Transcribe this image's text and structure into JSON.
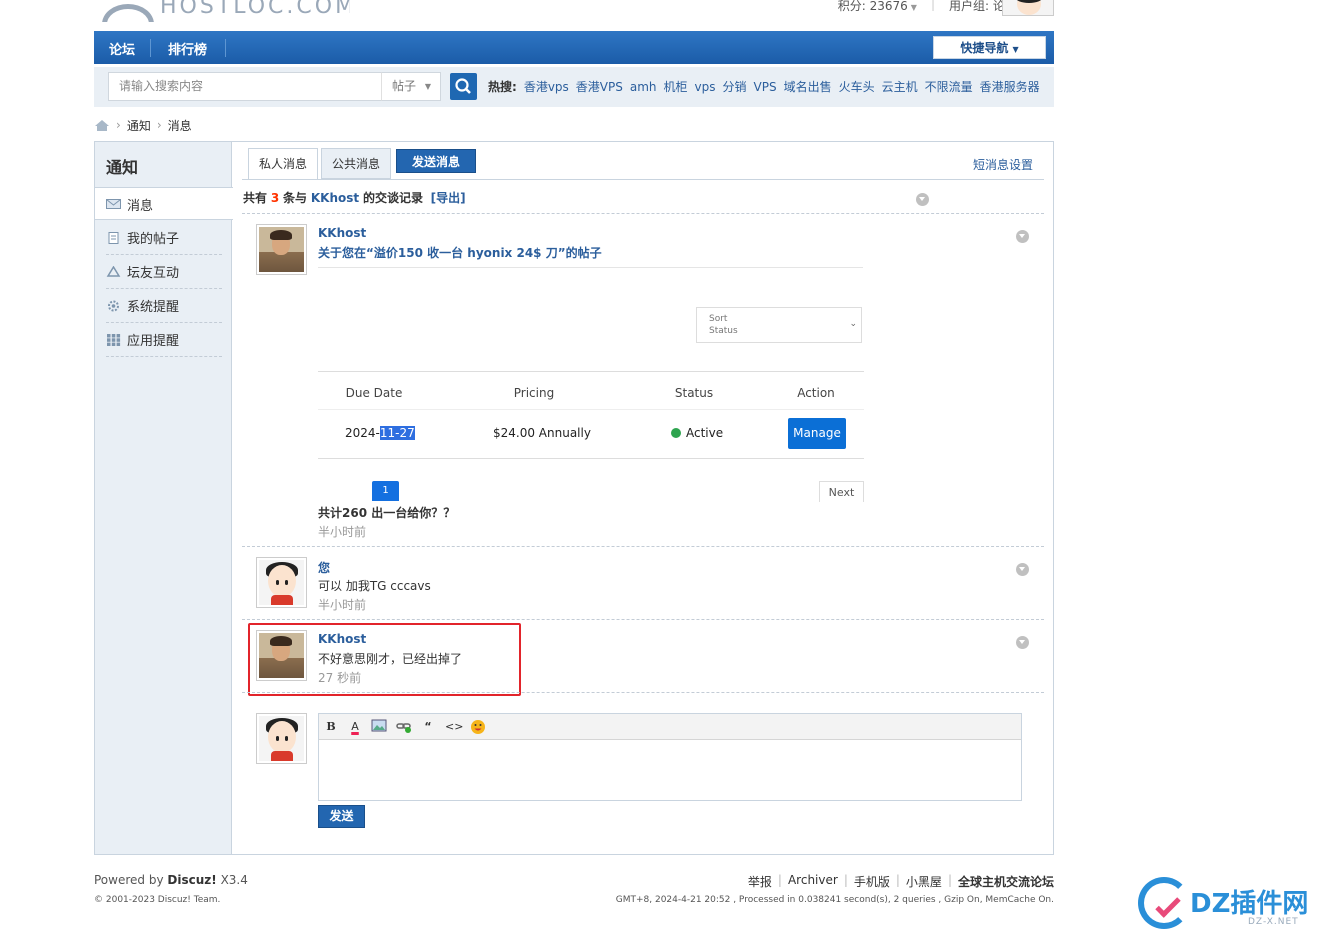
{
  "header": {
    "logo_text": "HOSTLOC.COM",
    "points": "积分: 23676",
    "usergroup": "用户组: 论坛神仙"
  },
  "nav": {
    "items": [
      "论坛",
      "排行榜"
    ],
    "quick_nav": "快捷导航"
  },
  "search": {
    "placeholder": "请输入搜索内容",
    "type": "帖子",
    "hot_label": "热搜:",
    "hot_keywords": [
      "香港vps",
      "香港VPS",
      "amh",
      "机柜",
      "vps",
      "分销",
      "VPS",
      "域名出售",
      "火车头",
      "云主机",
      "不限流量",
      "香港服务器"
    ]
  },
  "breadcrumb": [
    "通知",
    "消息"
  ],
  "sidebar": {
    "title": "通知",
    "items": [
      {
        "label": "消息",
        "icon": "envelope-icon"
      },
      {
        "label": "我的帖子",
        "icon": "document-icon"
      },
      {
        "label": "坛友互动",
        "icon": "recycle-icon"
      },
      {
        "label": "系统提醒",
        "icon": "gear-icon"
      },
      {
        "label": "应用提醒",
        "icon": "grid-icon"
      }
    ]
  },
  "tabs": {
    "private": "私人消息",
    "public": "公共消息",
    "send": "发送消息",
    "settings": "短消息设置"
  },
  "summary": {
    "prefix": "共有",
    "count": "3",
    "mid": "条与",
    "user": "KKhost",
    "suffix": "的交谈记录",
    "export": "[导出]"
  },
  "messages": [
    {
      "author": "KKhost",
      "title": "关于您在“溢价150 收一台 hyonix 24$ 刀”的帖子",
      "embed": {
        "sort_label_1": "Sort",
        "sort_label_2": "Status",
        "headers": [
          "Due Date",
          "Pricing",
          "Status",
          "Action"
        ],
        "due_date_a": "2024-",
        "due_date_b": "11-27",
        "pricing": "$24.00 Annually",
        "status": "Active",
        "action": "Manage",
        "page": "1",
        "next": "Next"
      },
      "text": "共计260 出一台给你？？",
      "time": "半小时前"
    },
    {
      "author": "您",
      "text": "可以 加我TG cccavs",
      "time": "半小时前"
    },
    {
      "author": "KKhost",
      "text": "不好意思刚才，已经出掉了",
      "time": "27 秒前"
    }
  ],
  "editor": {
    "tools": [
      "B",
      "A",
      "image",
      "link",
      "“",
      "<>",
      "smiley"
    ],
    "send": "发送"
  },
  "footer": {
    "powered_prefix": "Powered by",
    "powered_name": "Discuz!",
    "powered_ver": "X3.4",
    "copyright": "© 2001-2023 Discuz! Team.",
    "links": [
      "举报",
      "Archiver",
      "手机版",
      "小黑屋"
    ],
    "site": "全球主机交流论坛",
    "info": "GMT+8, 2024-4-21 20:52 , Processed in 0.038241 second(s), 2 queries , Gzip On, MemCache On."
  },
  "watermark": {
    "text": "DZ插件网",
    "sub": "DZ-X.NET"
  }
}
